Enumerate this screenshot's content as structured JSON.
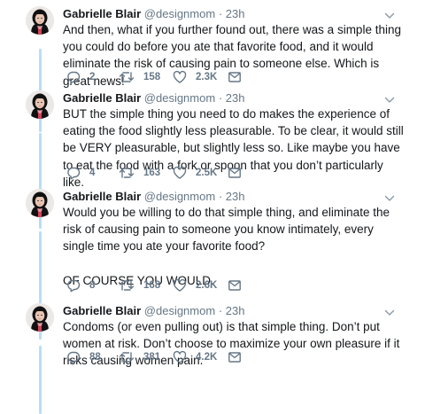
{
  "author": {
    "name": "Gabrielle Blair",
    "handle": "@designmom",
    "separator": "·",
    "avatar_icon": "profile-photo"
  },
  "colors": {
    "thread_line": "#b6dff5",
    "secondary_text": "#657786",
    "primary_text": "#14171a"
  },
  "tweets": [
    {
      "time": "23h",
      "text": [
        "And then, what if you further found out, there was a simple thing you could do before you ate that favorite food, and it would eliminate the risk of causing pain to someone else. Which is great news!"
      ],
      "replies": "2",
      "retweets": "158",
      "likes": "2.3K"
    },
    {
      "time": "23h",
      "text": [
        "BUT the simple thing you need to do makes the experience of eating the food slightly less pleasurable. To be clear, it would still be VERY pleasurable, but slightly less so. Like maybe you have to eat the food with a fork or spoon that you don’t particularly like."
      ],
      "replies": "4",
      "retweets": "163",
      "likes": "2.5K"
    },
    {
      "time": "23h",
      "text": [
        "Would you be willing to do that simple thing, and eliminate the risk of causing pain to someone you know intimately, every single time you ate your favorite food?",
        "OF COURSE YOU WOULD."
      ],
      "replies": "8",
      "retweets": "168",
      "likes": "2.6K"
    },
    {
      "time": "23h",
      "text": [
        "Condoms (or even pulling out) is that simple thing. Don’t put women at risk. Don’t choose to maximize your own pleasure if it risks causing women pain."
      ],
      "replies": "88",
      "retweets": "381",
      "likes": "4.2K"
    }
  ]
}
